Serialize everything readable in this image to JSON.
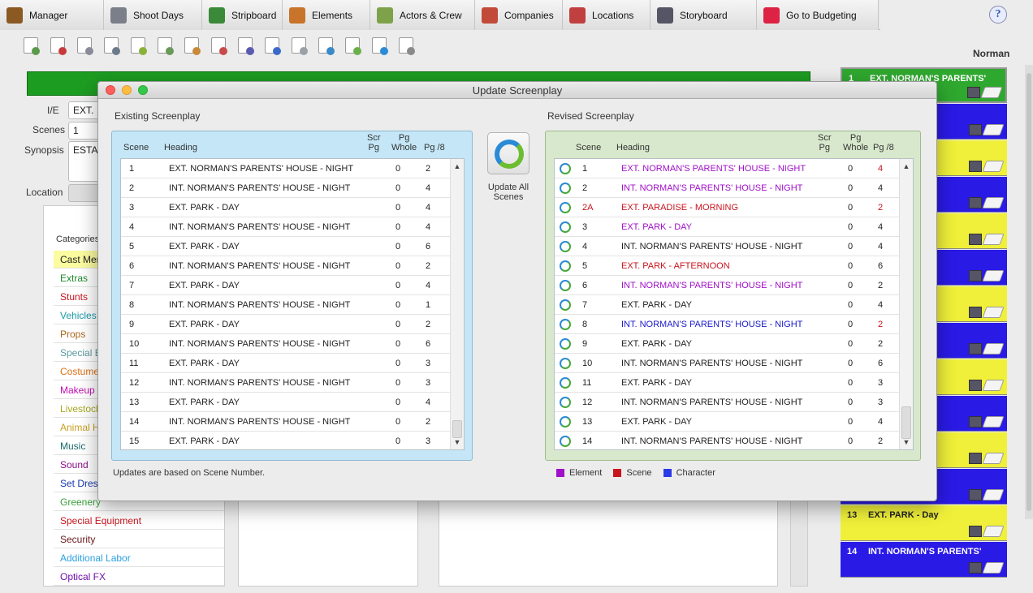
{
  "nav": {
    "tabs": [
      {
        "label": "Manager",
        "icon": "briefcase-icon",
        "color": "#8a5a22"
      },
      {
        "label": "Shoot Days",
        "icon": "calendar-icon",
        "color": "#7a7f8a"
      },
      {
        "label": "Stripboard",
        "icon": "stripboard-icon",
        "color": "#3a8a3a"
      },
      {
        "label": "Elements",
        "icon": "gun-icon",
        "color": "#c8742a"
      },
      {
        "label": "Actors & Crew",
        "icon": "actor-icon",
        "color": "#7ea24a"
      },
      {
        "label": "Companies",
        "icon": "people-icon",
        "color": "#c24a3a"
      },
      {
        "label": "Locations",
        "icon": "target-icon",
        "color": "#c04040"
      },
      {
        "label": "Storyboard",
        "icon": "storyboard-icon",
        "color": "#556"
      },
      {
        "label": "Go to Budgeting",
        "icon": "budget-icon",
        "color": "#d24"
      }
    ],
    "help_label": "?"
  },
  "toolbar": {
    "icons": [
      "new-scene-icon",
      "delete-scene-icon",
      "duplicate-icon",
      "find-icon",
      "list-icon",
      "export-icon",
      "import-icon",
      "table-icon",
      "magic-icon",
      "sort-icon",
      "link-icon",
      "search-doc-icon",
      "add-doc-icon",
      "sync-icon",
      "box-icon"
    ]
  },
  "user": {
    "name": "Norman"
  },
  "form": {
    "ie_label": "I/E",
    "ie_value": "EXT.",
    "scenes_label": "Scenes",
    "scenes_value": "1",
    "synopsis_label": "Synopsis",
    "synopsis_value": "ESTA",
    "location_label": "Location"
  },
  "categories": {
    "title": "Categories",
    "items": [
      {
        "label": "Cast Members",
        "color": "#222"
      },
      {
        "label": "Extras",
        "color": "#1f8a2a"
      },
      {
        "label": "Stunts",
        "color": "#c8141e"
      },
      {
        "label": "Vehicles",
        "color": "#1a9aa8"
      },
      {
        "label": "Props",
        "color": "#a8661a"
      },
      {
        "label": "Special Effects",
        "color": "#5a9aa0"
      },
      {
        "label": "Costumes",
        "color": "#e07010"
      },
      {
        "label": "Makeup",
        "color": "#c010b0"
      },
      {
        "label": "Livestock",
        "color": "#a8a820"
      },
      {
        "label": "Animal Handlers",
        "color": "#c8a020"
      },
      {
        "label": "Music",
        "color": "#1a6a6a"
      },
      {
        "label": "Sound",
        "color": "#8a108a"
      },
      {
        "label": "Set Dressing",
        "color": "#1a3ab0"
      },
      {
        "label": "Greenery",
        "color": "#3aa03a"
      },
      {
        "label": "Special Equipment",
        "color": "#c8141e"
      },
      {
        "label": "Security",
        "color": "#6a1a1a"
      },
      {
        "label": "Additional Labor",
        "color": "#2aa0e0"
      },
      {
        "label": "Optical FX",
        "color": "#7010a8"
      }
    ]
  },
  "strips": [
    {
      "num": "1",
      "text": "EXT.  NORMAN'S PARENTS'",
      "bg": "#2fa82f",
      "fg": "#fff"
    },
    {
      "num": "",
      "text": "'S PARENTS'",
      "bg": "#2a1ae6",
      "fg": "#fff"
    },
    {
      "num": "",
      "text": "",
      "bg": "#f0f03a",
      "fg": "#222"
    },
    {
      "num": "",
      "text": "'S PARENTS'",
      "bg": "#2a1ae6",
      "fg": "#fff"
    },
    {
      "num": "",
      "text": "",
      "bg": "#f0f03a",
      "fg": "#222"
    },
    {
      "num": "",
      "text": "'S PARENTS'",
      "bg": "#2a1ae6",
      "fg": "#fff"
    },
    {
      "num": "",
      "text": "",
      "bg": "#f0f03a",
      "fg": "#222"
    },
    {
      "num": "",
      "text": "'S PARENTS'",
      "bg": "#2a1ae6",
      "fg": "#fff"
    },
    {
      "num": "",
      "text": "",
      "bg": "#f0f03a",
      "fg": "#222"
    },
    {
      "num": "",
      "text": "'S PARENTS'",
      "bg": "#2a1ae6",
      "fg": "#fff"
    },
    {
      "num": "",
      "text": "",
      "bg": "#f0f03a",
      "fg": "#222"
    },
    {
      "num": "",
      "text": "'S PARENTS'",
      "bg": "#2a1ae6",
      "fg": "#fff"
    },
    {
      "num": "13",
      "text": "EXT.  PARK - Day",
      "bg": "#f0f03a",
      "fg": "#222"
    },
    {
      "num": "14",
      "text": "INT.  NORMAN'S PARENTS'",
      "bg": "#2a1ae6",
      "fg": "#fff"
    }
  ],
  "dialog": {
    "title": "Update Screenplay",
    "existing_title": "Existing Screenplay",
    "revised_title": "Revised Screenplay",
    "headers": {
      "scene": "Scene",
      "heading": "Heading",
      "scr_pg": "Scr\nPg",
      "pg_whole": "Pg\nWhole",
      "pg_8": "Pg /8"
    },
    "existing_rows": [
      {
        "scene": "1",
        "heading": "EXT. NORMAN'S PARENTS' HOUSE - NIGHT",
        "whole": "0",
        "eighths": "2"
      },
      {
        "scene": "2",
        "heading": "INT. NORMAN'S PARENTS' HOUSE - NIGHT",
        "whole": "0",
        "eighths": "4"
      },
      {
        "scene": "3",
        "heading": "EXT. PARK - DAY",
        "whole": "0",
        "eighths": "4"
      },
      {
        "scene": "4",
        "heading": "INT. NORMAN'S PARENTS' HOUSE - NIGHT",
        "whole": "0",
        "eighths": "4"
      },
      {
        "scene": "5",
        "heading": "EXT. PARK - DAY",
        "whole": "0",
        "eighths": "6"
      },
      {
        "scene": "6",
        "heading": "INT. NORMAN'S PARENTS' HOUSE - NIGHT",
        "whole": "0",
        "eighths": "2"
      },
      {
        "scene": "7",
        "heading": "EXT. PARK - DAY",
        "whole": "0",
        "eighths": "4"
      },
      {
        "scene": "8",
        "heading": "INT. NORMAN'S PARENTS' HOUSE - NIGHT",
        "whole": "0",
        "eighths": "1"
      },
      {
        "scene": "9",
        "heading": "EXT. PARK - DAY",
        "whole": "0",
        "eighths": "2"
      },
      {
        "scene": "10",
        "heading": "INT. NORMAN'S PARENTS' HOUSE - NIGHT",
        "whole": "0",
        "eighths": "6"
      },
      {
        "scene": "11",
        "heading": "EXT. PARK - DAY",
        "whole": "0",
        "eighths": "3"
      },
      {
        "scene": "12",
        "heading": "INT. NORMAN'S PARENTS' HOUSE - NIGHT",
        "whole": "0",
        "eighths": "3"
      },
      {
        "scene": "13",
        "heading": "EXT. PARK - DAY",
        "whole": "0",
        "eighths": "4"
      },
      {
        "scene": "14",
        "heading": "INT. NORMAN'S PARENTS' HOUSE - NIGHT",
        "whole": "0",
        "eighths": "2"
      },
      {
        "scene": "15",
        "heading": "EXT. PARK - DAY",
        "whole": "0",
        "eighths": "3"
      }
    ],
    "revised_rows": [
      {
        "scene": "1",
        "heading": "EXT. NORMAN'S PARENTS' HOUSE - NIGHT",
        "whole": "0",
        "eighths": "4",
        "scene_color": "#222",
        "heading_color": "#a010c8",
        "eighths_color": "#c8141e"
      },
      {
        "scene": "2",
        "heading": "INT. NORMAN'S PARENTS' HOUSE - NIGHT",
        "whole": "0",
        "eighths": "4",
        "scene_color": "#222",
        "heading_color": "#a010c8",
        "eighths_color": "#222"
      },
      {
        "scene": "2A",
        "heading": "EXT. PARADISE - MORNING",
        "whole": "0",
        "eighths": "2",
        "scene_color": "#c8141e",
        "heading_color": "#c8141e",
        "eighths_color": "#c8141e"
      },
      {
        "scene": "3",
        "heading": "EXT. PARK - DAY",
        "whole": "0",
        "eighths": "4",
        "scene_color": "#222",
        "heading_color": "#a010c8",
        "eighths_color": "#222"
      },
      {
        "scene": "4",
        "heading": "INT. NORMAN'S PARENTS' HOUSE - NIGHT",
        "whole": "0",
        "eighths": "4",
        "scene_color": "#222",
        "heading_color": "#222",
        "eighths_color": "#222"
      },
      {
        "scene": "5",
        "heading": "EXT. PARK - AFTERNOON",
        "whole": "0",
        "eighths": "6",
        "scene_color": "#222",
        "heading_color": "#c8141e",
        "eighths_color": "#222"
      },
      {
        "scene": "6",
        "heading": "INT. NORMAN'S PARENTS' HOUSE - NIGHT",
        "whole": "0",
        "eighths": "2",
        "scene_color": "#222",
        "heading_color": "#a010c8",
        "eighths_color": "#222"
      },
      {
        "scene": "7",
        "heading": "EXT. PARK - DAY",
        "whole": "0",
        "eighths": "4",
        "scene_color": "#222",
        "heading_color": "#222",
        "eighths_color": "#222"
      },
      {
        "scene": "8",
        "heading": "INT. NORMAN'S PARENTS' HOUSE - NIGHT",
        "whole": "0",
        "eighths": "2",
        "scene_color": "#222",
        "heading_color": "#1a1ac8",
        "eighths_color": "#c8141e"
      },
      {
        "scene": "9",
        "heading": "EXT. PARK - DAY",
        "whole": "0",
        "eighths": "2",
        "scene_color": "#222",
        "heading_color": "#222",
        "eighths_color": "#222"
      },
      {
        "scene": "10",
        "heading": "INT. NORMAN'S PARENTS' HOUSE - NIGHT",
        "whole": "0",
        "eighths": "6",
        "scene_color": "#222",
        "heading_color": "#222",
        "eighths_color": "#222"
      },
      {
        "scene": "11",
        "heading": "EXT. PARK - DAY",
        "whole": "0",
        "eighths": "3",
        "scene_color": "#222",
        "heading_color": "#222",
        "eighths_color": "#222"
      },
      {
        "scene": "12",
        "heading": "INT. NORMAN'S PARENTS' HOUSE - NIGHT",
        "whole": "0",
        "eighths": "3",
        "scene_color": "#222",
        "heading_color": "#222",
        "eighths_color": "#222"
      },
      {
        "scene": "13",
        "heading": "EXT. PARK - DAY",
        "whole": "0",
        "eighths": "4",
        "scene_color": "#222",
        "heading_color": "#222",
        "eighths_color": "#222"
      },
      {
        "scene": "14",
        "heading": "INT. NORMAN'S PARENTS' HOUSE - NIGHT",
        "whole": "0",
        "eighths": "2",
        "scene_color": "#222",
        "heading_color": "#222",
        "eighths_color": "#222"
      }
    ],
    "update_all_label": "Update All\nScenes",
    "footnote": "Updates are based on Scene Number.",
    "legend": [
      {
        "label": "Element",
        "color": "#a010c8"
      },
      {
        "label": "Scene",
        "color": "#c8141e"
      },
      {
        "label": "Character",
        "color": "#2a3ae6"
      }
    ],
    "colors": {
      "existing_bg": "#c4e6f7",
      "existing_border": "#8cbad3",
      "revised_bg": "#d8e8cc",
      "revised_border": "#9fbb8a"
    }
  }
}
